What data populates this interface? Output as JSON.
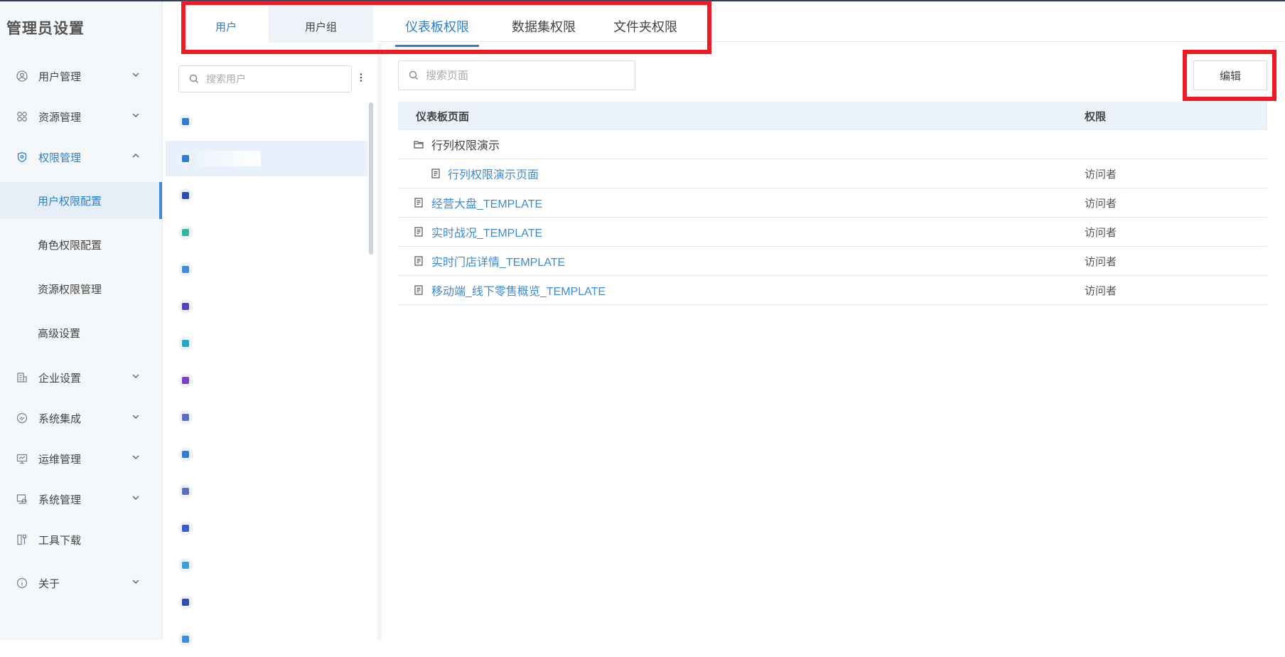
{
  "sidebar": {
    "title": "管理员设置",
    "nav": [
      {
        "label": "用户管理",
        "icon": "user-circle-icon"
      },
      {
        "label": "资源管理",
        "icon": "grid-icon"
      },
      {
        "label": "权限管理",
        "icon": "shield-icon"
      },
      {
        "label": "企业设置",
        "icon": "building-icon"
      },
      {
        "label": "系统集成",
        "icon": "integration-icon"
      },
      {
        "label": "运维管理",
        "icon": "monitor-icon"
      },
      {
        "label": "系统管理",
        "icon": "system-icon"
      },
      {
        "label": "工具下载",
        "icon": "tools-icon"
      },
      {
        "label": "关于",
        "icon": "info-icon"
      }
    ],
    "sub_items": [
      "用户权限配置",
      "角色权限配置",
      "资源权限管理",
      "高级设置"
    ]
  },
  "tabs": {
    "user": "用户",
    "user_group": "用户组",
    "dashboard": "仪表板权限",
    "dataset": "数据集权限",
    "folder": "文件夹权限"
  },
  "user_panel": {
    "search_placeholder": "搜索用户",
    "avatar_colors": [
      "#2e7dd1",
      "#2e7dd1",
      "#2a4fb0",
      "#2fb8a0",
      "#3b8fd8",
      "#5540c0",
      "#1fa8c8",
      "#7b3fc8",
      "#5a6fc0",
      "#2e7dd1",
      "#5a6fc0",
      "#3a5bd0",
      "#3b9fd8",
      "#2a4fb0",
      "#3b8fd8"
    ]
  },
  "content": {
    "search_placeholder": "搜索页面",
    "edit_label": "编辑",
    "columns": {
      "page": "仪表板页面",
      "permission": "权限"
    },
    "rows": [
      {
        "name": "行列权限演示",
        "type": "folder",
        "permission": ""
      },
      {
        "name": "行列权限演示页面",
        "type": "page",
        "permission": "访问者"
      },
      {
        "name": "经营大盘_TEMPLATE",
        "type": "page",
        "permission": "访问者"
      },
      {
        "name": "实时战况_TEMPLATE",
        "type": "page",
        "permission": "访问者"
      },
      {
        "name": "实时门店详情_TEMPLATE",
        "type": "page",
        "permission": "访问者"
      },
      {
        "name": "移动端_线下零售概览_TEMPLATE",
        "type": "page",
        "permission": "访问者"
      }
    ]
  }
}
